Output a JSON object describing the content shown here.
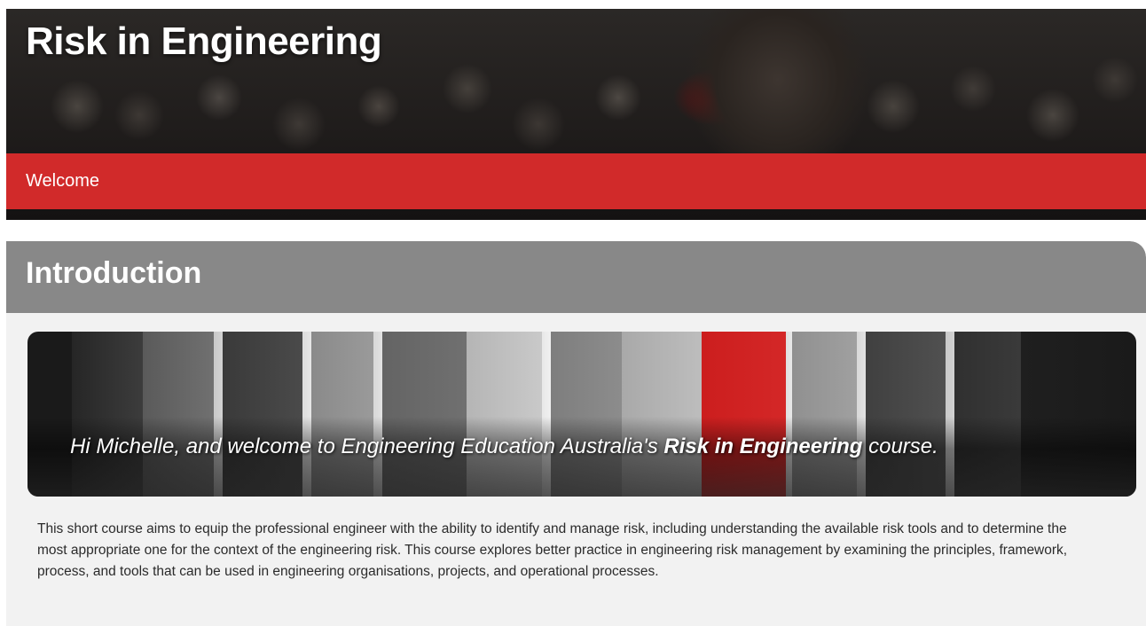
{
  "hero": {
    "title": "Risk in Engineering",
    "welcome_link": "Welcome"
  },
  "intro_section": {
    "title": "Introduction",
    "banner": {
      "greeting": "Hi Michelle, and welcome to Engineering Education Australia's",
      "course_name": "Risk in Engineering",
      "suffix": "course."
    },
    "paragraph": "This short course aims to equip the professional engineer with the ability to identify and manage risk, including understanding the available risk tools and to determine the most appropriate one for the context of the engineering risk. This course explores better practice in engineering risk management by examining the principles, framework, process, and tools that can be used in engineering organisations, projects, and operational processes."
  },
  "colors": {
    "accent_red": "#d12a2a",
    "section_header_gray": "#888888",
    "section_background": "#f2f2f2"
  }
}
